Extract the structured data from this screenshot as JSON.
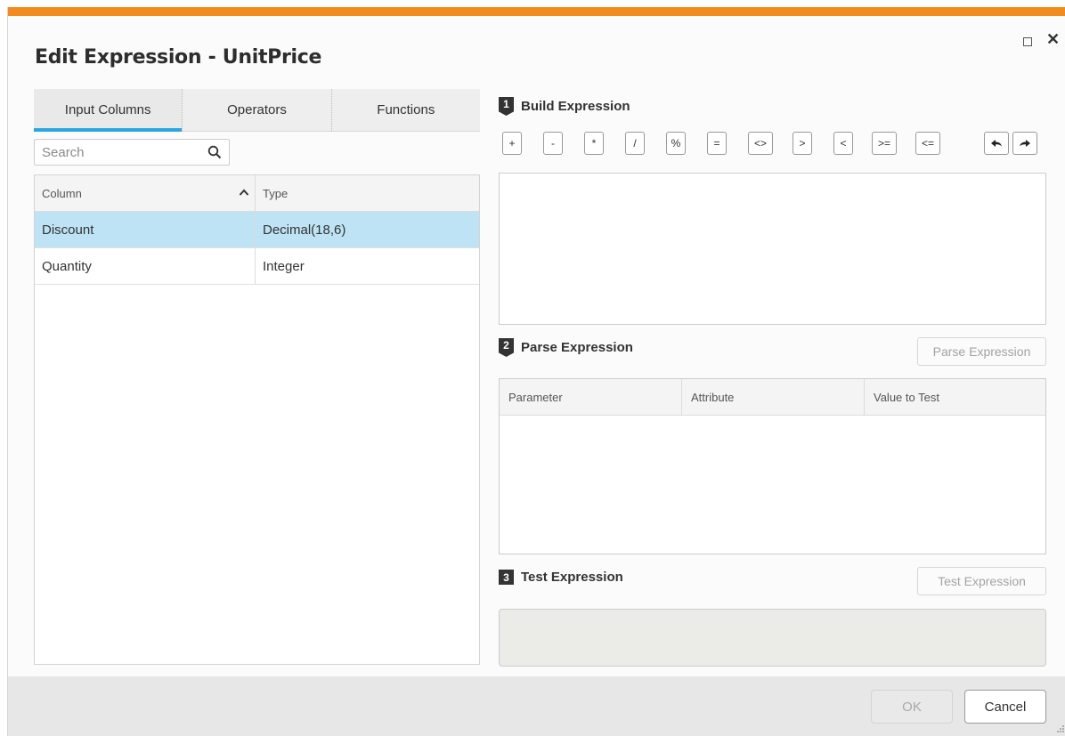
{
  "dialog": {
    "title": "Edit Expression - UnitPrice",
    "accent_color": "#f28a1e",
    "window_controls": [
      "maximize-icon",
      "close-icon"
    ]
  },
  "left_panel": {
    "tabs": [
      {
        "label": "Input Columns",
        "active": true
      },
      {
        "label": "Operators",
        "active": false
      },
      {
        "label": "Functions",
        "active": false
      }
    ],
    "search": {
      "placeholder": "Search",
      "value": "",
      "icon": "search-icon"
    },
    "table": {
      "headers": [
        "Column",
        "Type"
      ],
      "sort_icon": "chevron-up-icon",
      "rows": [
        {
          "column": "Discount",
          "type": "Decimal(18,6)",
          "selected": true
        },
        {
          "column": "Quantity",
          "type": "Integer",
          "selected": false
        }
      ]
    }
  },
  "build": {
    "step": "1",
    "title": "Build Expression",
    "operators": [
      "+",
      "-",
      "*",
      "/",
      "%",
      "=",
      "<>",
      ">",
      "<",
      ">=",
      "<="
    ],
    "undo_icon": "undo-icon",
    "redo_icon": "redo-icon",
    "expression_value": ""
  },
  "parse": {
    "step": "2",
    "title": "Parse Expression",
    "button_label": "Parse Expression",
    "headers": [
      "Parameter",
      "Attribute",
      "Value to Test"
    ]
  },
  "test": {
    "step": "3",
    "title": "Test Expression",
    "button_label": "Test Expression",
    "result": ""
  },
  "footer": {
    "ok_label": "OK",
    "cancel_label": "Cancel"
  },
  "colors": {
    "selected_row": "#bde3f4",
    "active_tab_underline": "#2ba6de"
  }
}
